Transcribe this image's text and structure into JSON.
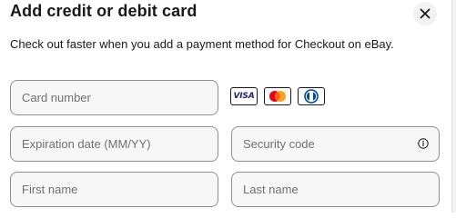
{
  "dialog": {
    "title": "Add credit or debit card",
    "subtitle": "Check out faster when you add a payment method for Checkout on eBay."
  },
  "close_icon": "close-icon",
  "form": {
    "card_number": {
      "placeholder": "Card number",
      "value": ""
    },
    "expiration": {
      "placeholder": "Expiration date (MM/YY)",
      "value": ""
    },
    "security_code": {
      "placeholder": "Security code",
      "value": "",
      "info_icon": "info-icon"
    },
    "first_name": {
      "placeholder": "First name",
      "value": ""
    },
    "last_name": {
      "placeholder": "Last name",
      "value": ""
    }
  },
  "card_logos": {
    "visa": "VISA",
    "mastercard": "mastercard-logo",
    "diners": "diners-club-logo"
  },
  "colors": {
    "text": "#191919",
    "placeholder": "#707070",
    "field_border": "#8f8f8f",
    "field_bg": "#f7f7f7",
    "visa_blue": "#1a1f71",
    "mc_red": "#eb001b",
    "mc_orange": "#f79e1b",
    "diners_blue": "#004a97"
  }
}
